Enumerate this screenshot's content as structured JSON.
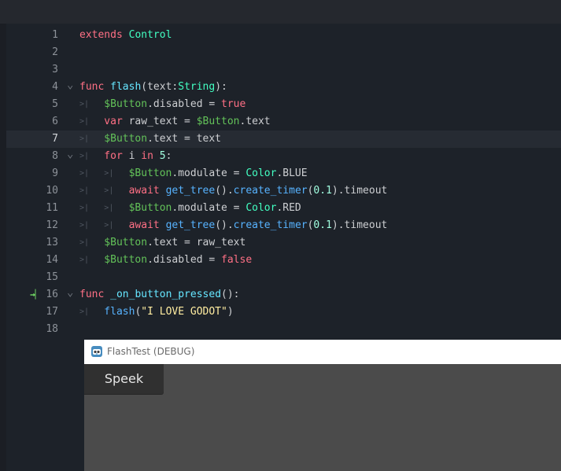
{
  "editor": {
    "lines": [
      {
        "n": "1",
        "t": [
          {
            "c": "kw",
            "s": "extends"
          },
          {
            "c": "tx",
            "s": " "
          },
          {
            "c": "tp",
            "s": "Control"
          }
        ]
      },
      {
        "n": "2",
        "t": []
      },
      {
        "n": "3",
        "t": []
      },
      {
        "n": "4",
        "fold": true,
        "t": [
          {
            "c": "kw",
            "s": "func"
          },
          {
            "c": "tx",
            "s": " "
          },
          {
            "c": "fnd",
            "s": "flash"
          },
          {
            "c": "tx",
            "s": "(text:"
          },
          {
            "c": "tp",
            "s": "String"
          },
          {
            "c": "tx",
            "s": "):"
          }
        ]
      },
      {
        "n": "5",
        "indent": 1,
        "t": [
          {
            "c": "nd",
            "s": "$Button"
          },
          {
            "c": "tx",
            "s": ".disabled = "
          },
          {
            "c": "kw",
            "s": "true"
          }
        ]
      },
      {
        "n": "6",
        "indent": 1,
        "t": [
          {
            "c": "kw",
            "s": "var"
          },
          {
            "c": "tx",
            "s": " raw_text = "
          },
          {
            "c": "nd",
            "s": "$Button"
          },
          {
            "c": "tx",
            "s": ".text"
          }
        ]
      },
      {
        "n": "7",
        "indent": 1,
        "current": true,
        "t": [
          {
            "c": "nd",
            "s": "$Button"
          },
          {
            "c": "tx",
            "s": ".text = text"
          }
        ]
      },
      {
        "n": "8",
        "indent": 1,
        "fold": true,
        "t": [
          {
            "c": "kw",
            "s": "for"
          },
          {
            "c": "tx",
            "s": " i "
          },
          {
            "c": "kw",
            "s": "in"
          },
          {
            "c": "tx",
            "s": " "
          },
          {
            "c": "num",
            "s": "5"
          },
          {
            "c": "tx",
            "s": ":"
          }
        ]
      },
      {
        "n": "9",
        "indent": 2,
        "t": [
          {
            "c": "nd",
            "s": "$Button"
          },
          {
            "c": "tx",
            "s": ".modulate = "
          },
          {
            "c": "tp",
            "s": "Color"
          },
          {
            "c": "tx",
            "s": ".BLUE"
          }
        ]
      },
      {
        "n": "10",
        "indent": 2,
        "t": [
          {
            "c": "kw",
            "s": "await"
          },
          {
            "c": "tx",
            "s": " "
          },
          {
            "c": "fn",
            "s": "get_tree"
          },
          {
            "c": "tx",
            "s": "()."
          },
          {
            "c": "fn",
            "s": "create_timer"
          },
          {
            "c": "tx",
            "s": "("
          },
          {
            "c": "num",
            "s": "0.1"
          },
          {
            "c": "tx",
            "s": ").timeout"
          }
        ]
      },
      {
        "n": "11",
        "indent": 2,
        "t": [
          {
            "c": "nd",
            "s": "$Button"
          },
          {
            "c": "tx",
            "s": ".modulate = "
          },
          {
            "c": "tp",
            "s": "Color"
          },
          {
            "c": "tx",
            "s": ".RED"
          }
        ]
      },
      {
        "n": "12",
        "indent": 2,
        "t": [
          {
            "c": "kw",
            "s": "await"
          },
          {
            "c": "tx",
            "s": " "
          },
          {
            "c": "fn",
            "s": "get_tree"
          },
          {
            "c": "tx",
            "s": "()."
          },
          {
            "c": "fn",
            "s": "create_timer"
          },
          {
            "c": "tx",
            "s": "("
          },
          {
            "c": "num",
            "s": "0.1"
          },
          {
            "c": "tx",
            "s": ").timeout"
          }
        ]
      },
      {
        "n": "13",
        "indent": 1,
        "t": [
          {
            "c": "nd",
            "s": "$Button"
          },
          {
            "c": "tx",
            "s": ".text = raw_text"
          }
        ]
      },
      {
        "n": "14",
        "indent": 1,
        "t": [
          {
            "c": "nd",
            "s": "$Button"
          },
          {
            "c": "tx",
            "s": ".disabled = "
          },
          {
            "c": "kw",
            "s": "false"
          }
        ]
      },
      {
        "n": "15",
        "t": []
      },
      {
        "n": "16",
        "fold": true,
        "connected": true,
        "t": [
          {
            "c": "kw",
            "s": "func"
          },
          {
            "c": "tx",
            "s": " "
          },
          {
            "c": "fnd",
            "s": "_on_button_pressed"
          },
          {
            "c": "tx",
            "s": "():"
          }
        ]
      },
      {
        "n": "17",
        "indent": 1,
        "t": [
          {
            "c": "fn",
            "s": "flash"
          },
          {
            "c": "tx",
            "s": "("
          },
          {
            "c": "str",
            "s": "\"I LOVE GODOT\""
          },
          {
            "c": "tx",
            "s": ")"
          }
        ]
      },
      {
        "n": "18",
        "t": []
      }
    ],
    "icons": {
      "fold": "fold-chevron-icon",
      "tab": "tab-indent-icon",
      "connection": "signal-connection-icon"
    },
    "colors": {
      "keyword": "#ff7085",
      "type": "#42ffc2",
      "function": "#57b3ff",
      "node_path": "#63c259",
      "number": "#a1ffe0",
      "string": "#ffeda1",
      "text": "#cdcfd2",
      "background": "#1d2229",
      "current_line": "#262b33"
    }
  },
  "game_window": {
    "title": "FlashTest (DEBUG)",
    "icon": "godot-logo-icon",
    "button_label": "Speek",
    "colors": {
      "titlebar": "#ffffff",
      "viewport": "#4b4b4b",
      "button": "#303030"
    }
  }
}
